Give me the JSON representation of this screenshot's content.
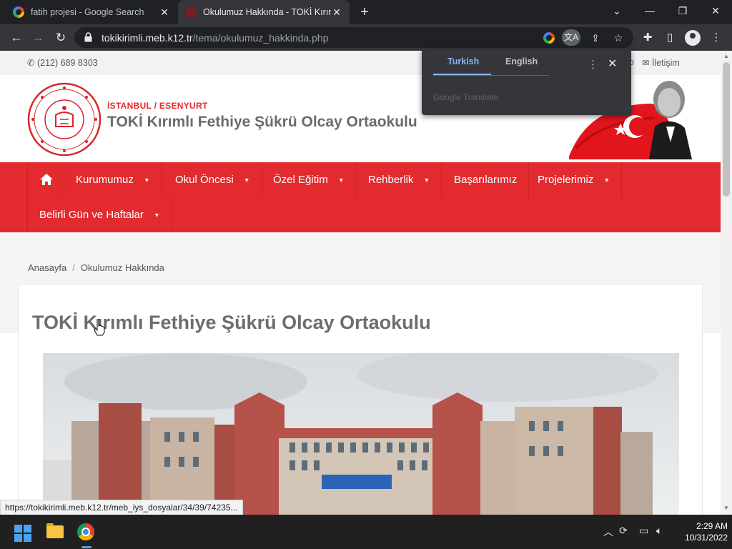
{
  "browser": {
    "tabs": [
      {
        "title": "fatih projesi - Google Search"
      },
      {
        "title": "Okulumuz Hakkında - TOKİ Kırım"
      }
    ],
    "url_domain": "tokikirimli.meb.k12.tr",
    "url_path": "/tema/okulumuz_hakkinda.php",
    "status_url": "https://tokikirimli.meb.k12.tr/meb_iys_dosyalar/34/39/74235..."
  },
  "translate_popup": {
    "tab_source": "Turkish",
    "tab_target": "English",
    "brand": "Google Translate"
  },
  "site": {
    "phone": "(212) 689 8303",
    "contact": "İletişim",
    "city": "İSTANBUL / ESENYURT",
    "school_name": "TOKİ Kırımlı Fethiye Şükrü Olcay Ortaokulu",
    "nav": [
      {
        "label": "Kurumumuz"
      },
      {
        "label": "Okul Öncesi"
      },
      {
        "label": "Özel Eğitim"
      },
      {
        "label": "Rehberlik"
      },
      {
        "label": "Başarılarımız"
      },
      {
        "label": "Projelerimiz"
      },
      {
        "label": "Belirli Gün ve Haftalar"
      }
    ],
    "breadcrumb": [
      "Anasayfa",
      "Okulumuz Hakkında"
    ],
    "page_title": "TOKİ Kırımlı Fethiye Şükrü Olcay Ortaokulu",
    "colors": {
      "brand_red": "#e32a2f",
      "title_gray": "#6d6d6d"
    }
  },
  "taskbar": {
    "time": "2:29 AM",
    "date": "10/31/2022"
  }
}
